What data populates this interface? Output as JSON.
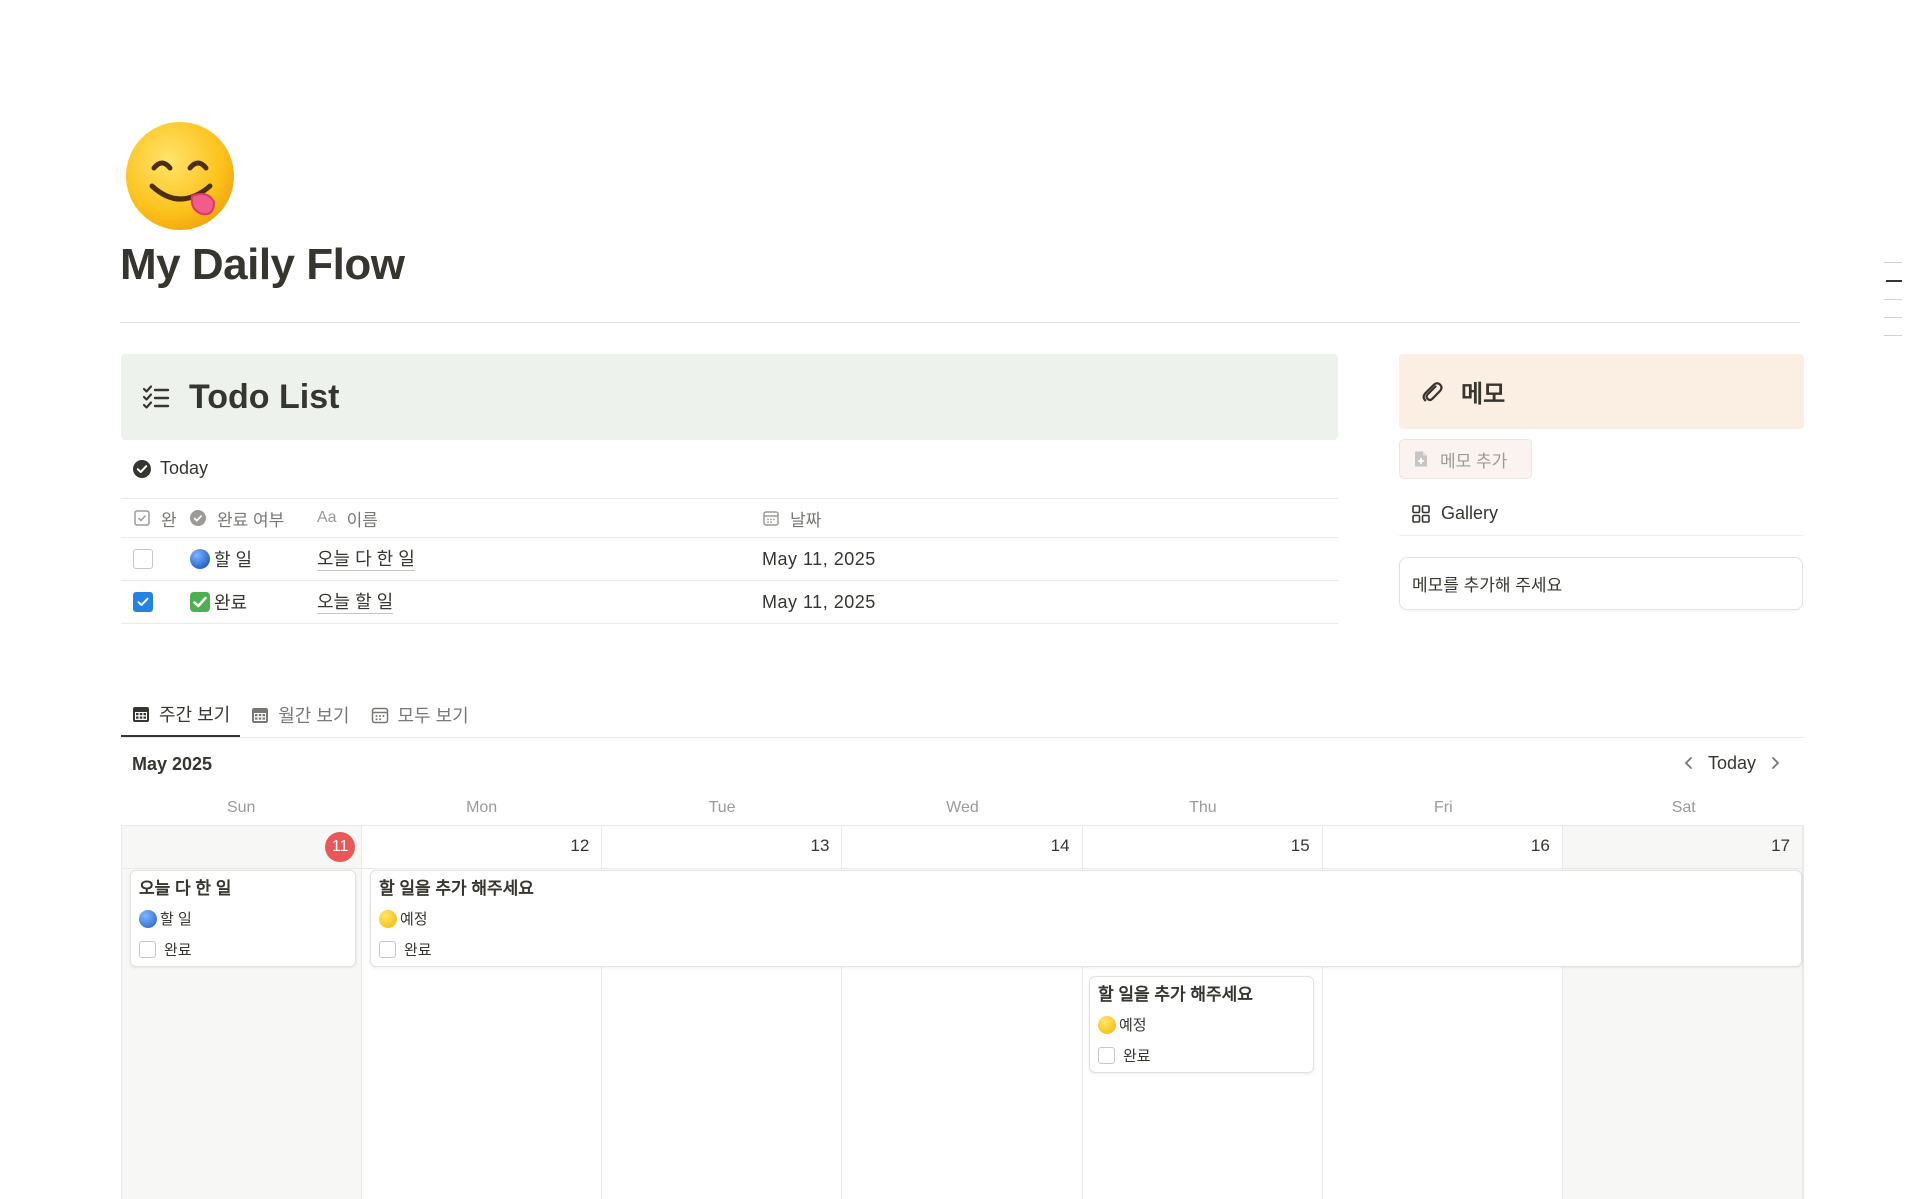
{
  "page": {
    "title": "My Daily Flow",
    "icon": "smiley-tongue-icon"
  },
  "todo": {
    "header_title": "Todo List",
    "view_label": "Today",
    "columns": [
      "완",
      "완료 여부",
      "이름",
      "날짜"
    ],
    "rows": [
      {
        "checked": false,
        "status": "할 일",
        "status_icon": "blue-circle",
        "name": "오늘 다 한 일",
        "date": "May 11, 2025"
      },
      {
        "checked": true,
        "status": "완료",
        "status_icon": "green-check",
        "name": "오늘 할 일",
        "date": "May 11, 2025"
      }
    ]
  },
  "memo": {
    "header_title": "메모",
    "add_label": "메모 추가",
    "gallery_label": "Gallery",
    "card_text": "메모를 추가해 주세요"
  },
  "calendar": {
    "tabs": [
      {
        "label": "주간 보기",
        "active": true
      },
      {
        "label": "월간 보기",
        "active": false
      },
      {
        "label": "모두 보기",
        "active": false
      }
    ],
    "month": "May 2025",
    "today_label": "Today",
    "weekdays": [
      "Sun",
      "Mon",
      "Tue",
      "Wed",
      "Thu",
      "Fri",
      "Sat"
    ],
    "dates": [
      "11",
      "12",
      "13",
      "14",
      "15",
      "16",
      "17"
    ],
    "today_index": 0,
    "events": [
      {
        "title": "오늘 다 한 일",
        "status": "할 일",
        "status_color": "#2b6fd6",
        "check_label": "완료"
      },
      {
        "title": "할 일을 추가 해주세요",
        "status": "예정",
        "status_color": "#f5c400",
        "check_label": "완료"
      },
      {
        "title": "할 일을 추가 해주세요",
        "status": "예정",
        "status_color": "#f5c400",
        "check_label": "완료"
      }
    ]
  },
  "colors": {
    "todo_header_bg": "#edf3ec",
    "memo_header_bg": "#fbeee2",
    "today_badge": "#eb5757",
    "checkbox_checked": "#2383e2"
  }
}
